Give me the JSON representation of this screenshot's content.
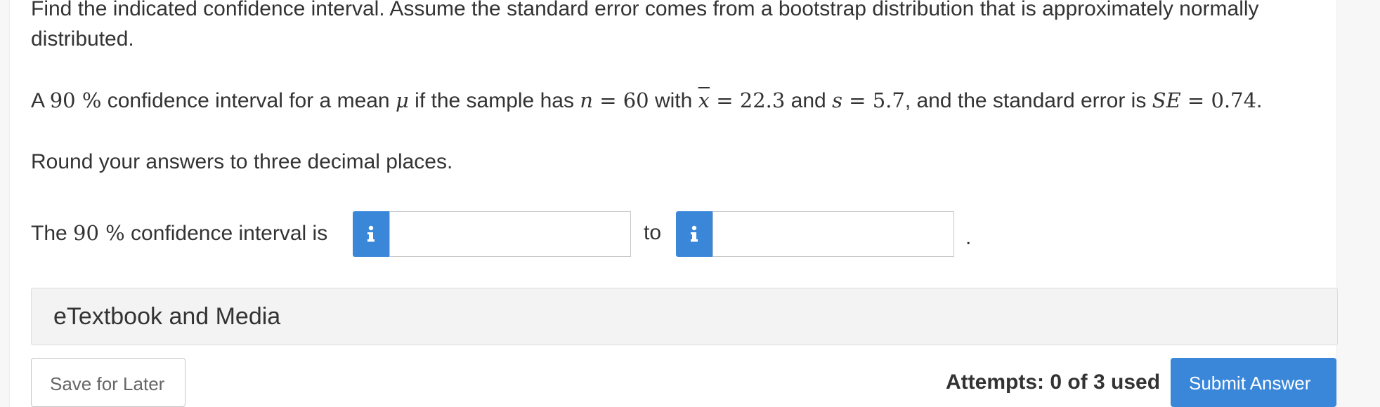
{
  "question": {
    "instruction_line1": "Find the indicated confidence interval. Assume the standard error comes from a bootstrap distribution that is approximately normally",
    "instruction_line2": "distributed.",
    "problem": {
      "t1": "A ",
      "conf": "90 %",
      "t2": " confidence interval for a mean ",
      "mu": "μ",
      "t3": " if the sample has ",
      "n_var": "n",
      "eq1": " = 60",
      "t4": " with ",
      "xbar_var": "x",
      "eq2": " = 22.3",
      "t5": " and ",
      "s_var": "s",
      "eq3": " = 5.7",
      "t6": ", and the standard error is ",
      "se_var": "SE",
      "eq4": " = 0.74",
      "t7": "."
    },
    "rounding_note": "Round your answers to three decimal places.",
    "answer_prefix": "The ",
    "answer_conf": "90 %",
    "answer_suffix": " confidence interval is",
    "to_word": "to",
    "period": ".",
    "lower_value": "",
    "upper_value": ""
  },
  "etextbook_label": "eTextbook and Media",
  "footer": {
    "save_label": "Save for Later",
    "attempts_label": "Attempts: 0 of 3 used",
    "submit_label": "Submit Answer"
  },
  "colors": {
    "accent": "#3a87d9",
    "text": "#333333",
    "panel": "#ffffff",
    "background": "#f7f7f7"
  },
  "icons": {
    "info": "info-icon"
  }
}
